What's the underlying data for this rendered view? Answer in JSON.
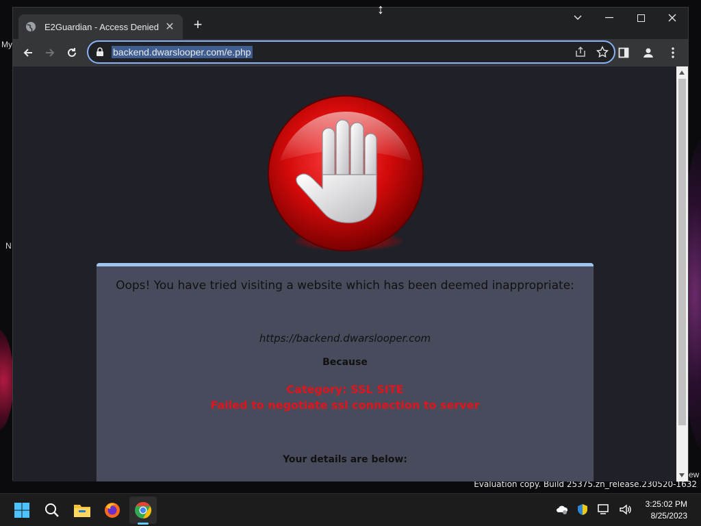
{
  "desktop": {
    "labels": [
      "My",
      "N",
      "ew"
    ],
    "watermark": "Evaluation copy. Build 25375.zn_release.230520-1632"
  },
  "browser": {
    "tab": {
      "title": "E2Guardian - Access Denied",
      "close": "✕"
    },
    "new_tab": "+",
    "address": {
      "url": "backend.dwarslooper.com/e.php"
    }
  },
  "page": {
    "headline": "Oops! You have tried visiting a website which has been deemed inappropriate:",
    "blocked_url": "https://backend.dwarslooper.com",
    "because": "Because",
    "reason_lines": [
      "Category: SSL SITE",
      "Failed to negotiate ssl connection to server"
    ],
    "details_heading": "Your details are below:"
  },
  "taskbar": {
    "apps": [
      "start-icon",
      "search-icon",
      "file-explorer-icon",
      "firefox-icon",
      "chrome-icon"
    ],
    "time": "3:25:02 PM",
    "date": "8/25/2023"
  },
  "colors": {
    "accent": "#8ab4f8",
    "reason_red": "#e0141c",
    "panel_bg": "#474b5c",
    "page_bg": "#1f2028"
  }
}
